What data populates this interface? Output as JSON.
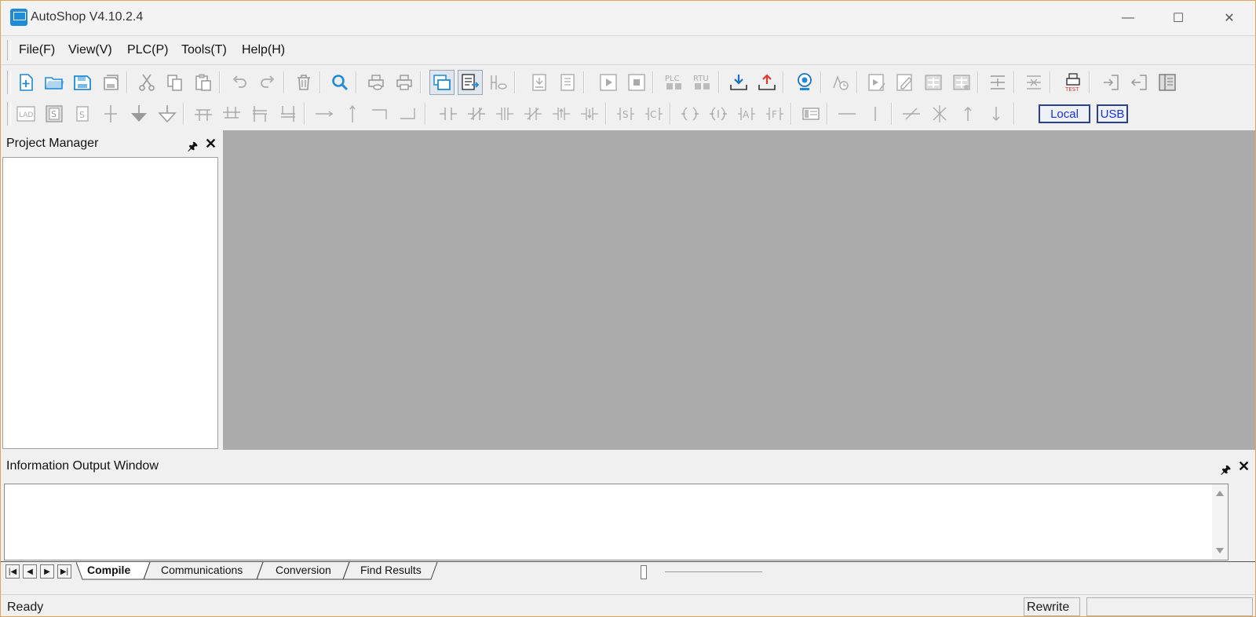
{
  "window": {
    "title": "AutoShop V4.10.2.4"
  },
  "window_controls": {
    "minimize": "—",
    "maximize": "☐",
    "close": "✕"
  },
  "menu": [
    {
      "label": "File(F)"
    },
    {
      "label": "View(V)"
    },
    {
      "label": "PLC(P)"
    },
    {
      "label": "Tools(T)"
    },
    {
      "label": "Help(H)"
    }
  ],
  "toolbar2": {
    "local_label": "Local",
    "usb_label": "USB"
  },
  "project_manager": {
    "title": "Project Manager",
    "pin": "🖈",
    "close": "✕"
  },
  "info_window": {
    "title": "Information Output Window",
    "pin": "🖈",
    "close": "✕"
  },
  "output_tabs": [
    "Compile",
    "Communications",
    "Conversion",
    "Find Results"
  ],
  "status": {
    "ready": "Ready",
    "mode": "Rewrite"
  },
  "colors": {
    "accent": "#1f8ad6",
    "workspace": "#ababab",
    "window_border": "#e2a35a"
  }
}
